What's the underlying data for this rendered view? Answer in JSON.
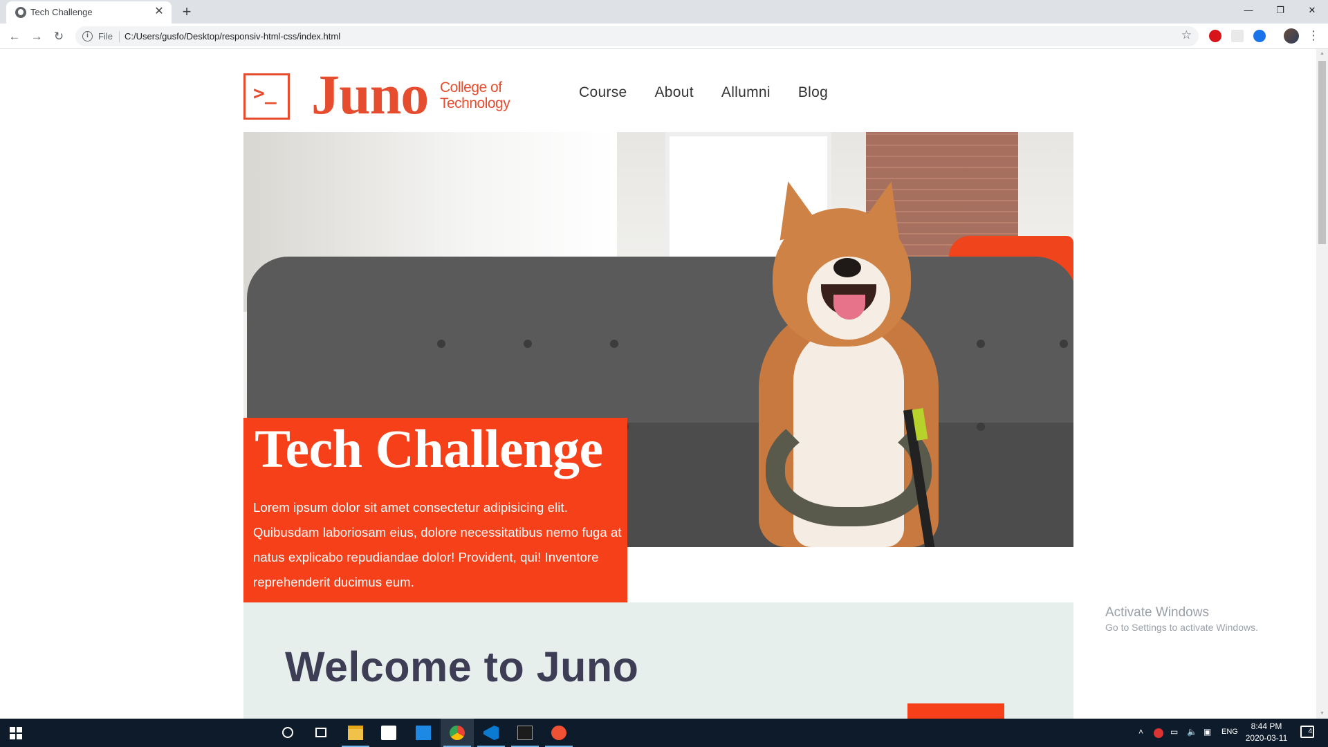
{
  "browser": {
    "tab_title": "Tech Challenge",
    "new_tab_label": "+",
    "file_label": "File",
    "url": "C:/Users/gusfo/Desktop/responsiv-html-css/index.html",
    "window_controls": [
      "—",
      "❐",
      "✕"
    ]
  },
  "site": {
    "logo_symbol": ">_",
    "logo_name": "Juno",
    "logo_tagline_line1": "College of",
    "logo_tagline_line2": "Technology",
    "nav": [
      "Course",
      "About",
      "Allumni",
      "Blog"
    ],
    "hero": {
      "title": "Tech Challenge",
      "text": "Lorem ipsum dolor sit amet consectetur adipisicing elit. Quibusdam laboriosam eius, dolore necessitatibus nemo fuga at natus explicabo repudiandae dolor! Provident, qui! Inventore reprehenderit ducimus eum."
    },
    "welcome_title": "Welcome to Juno",
    "accent_color": "#f5401a"
  },
  "watermark": {
    "line1": "Activate Windows",
    "line2": "Go to Settings to activate Windows."
  },
  "taskbar": {
    "tray_lang": "ENG",
    "time": "8:44 PM",
    "date": "2020-03-11",
    "notification_count": "4"
  }
}
